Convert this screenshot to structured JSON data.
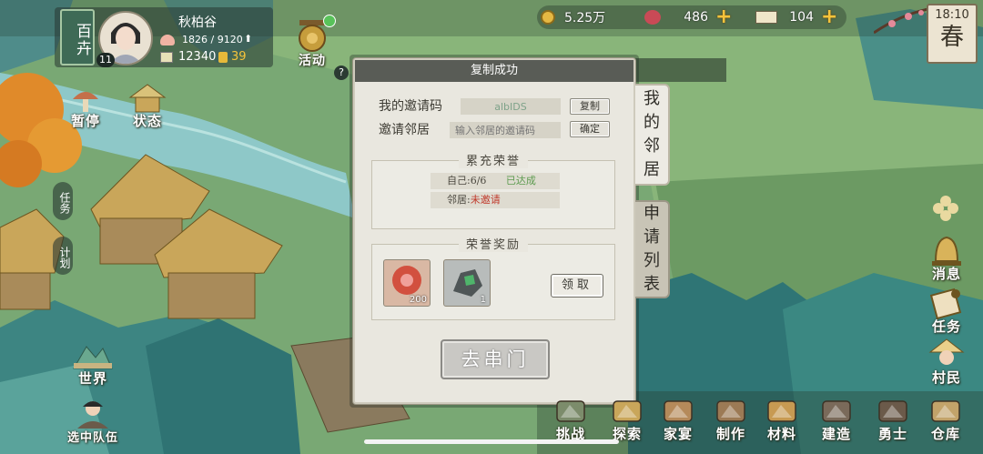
{
  "top_bar": {
    "village_name": "百卉",
    "player_level": "11",
    "player_name": "秋柏谷",
    "stamina": "1826 / 9120",
    "food": "12340",
    "food_count": "39",
    "event_label": "活动",
    "coins": "5.25万",
    "gems": "486",
    "tickets": "104",
    "time": "18:10",
    "season": "春"
  },
  "left_menu": {
    "pause": "暂停",
    "status": "状态",
    "tasks_side": "任务",
    "plan_side": "计划",
    "world": "世界",
    "team": "选中队伍"
  },
  "dialog": {
    "header": "复制成功",
    "my_code_label": "我的邀请码",
    "my_code_value": "albIDS",
    "copy_button": "复制",
    "invite_label": "邀请邻居",
    "invite_placeholder": "输入邻居的邀请码",
    "confirm_button": "确定",
    "honor_title": "累充荣誉",
    "self_progress": "自己:6/6",
    "self_status": "已达成",
    "neighbor_label": "邻居:",
    "neighbor_status": "未邀请",
    "reward_title": "荣誉奖励",
    "reward1_count": "200",
    "reward2_count": "1",
    "claim_button": "领取",
    "go_button": "去串门",
    "tab_neighbors": [
      "我",
      "的",
      "邻",
      "居"
    ],
    "tab_requests": [
      "申",
      "请",
      "列",
      "表"
    ]
  },
  "bottom_bar": [
    "挑战",
    "探索",
    "家宴",
    "制作",
    "材料",
    "建造",
    "勇士",
    "仓库"
  ],
  "right_menu": {
    "messages": "消息",
    "tasks": "任务",
    "villagers": "村民"
  },
  "colors": {
    "panel_bg": "#e9e7df",
    "achieved_green": "#5d9b4f",
    "not_invited_red": "#c0392b",
    "plus_gold": "#f5c33b"
  }
}
